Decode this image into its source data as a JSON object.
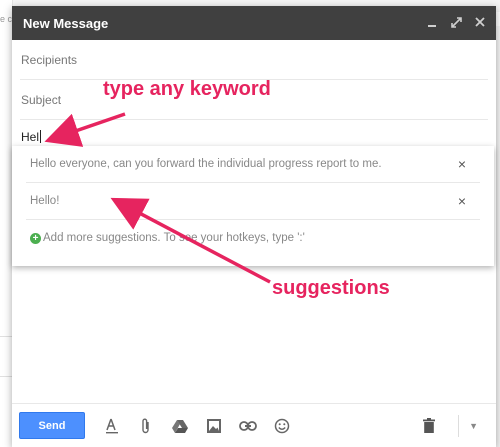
{
  "background": {
    "fragment_text": "e c"
  },
  "compose": {
    "title": "New Message",
    "recipients_placeholder": "Recipients",
    "subject_placeholder": "Subject",
    "body_text": "Hel"
  },
  "suggestions": {
    "items": [
      {
        "label": "Hello everyone, can you forward the individual progress report to me.",
        "close_icon": "×"
      },
      {
        "label": "Hello!",
        "close_icon": "×"
      }
    ],
    "add_more": "Add more suggestions. To see your hotkeys, type ':'"
  },
  "annotations": {
    "keyword_label": "type any keyword",
    "suggestions_label": "suggestions",
    "color": "#e6245f"
  },
  "toolbar": {
    "send_label": "Send",
    "icons": [
      "format-text-icon",
      "attach-icon",
      "drive-icon",
      "photo-icon",
      "link-icon",
      "emoji-icon",
      "trash-icon",
      "more-options-icon"
    ]
  },
  "colors": {
    "titlebar": "#404040",
    "send": "#4d90fe"
  }
}
